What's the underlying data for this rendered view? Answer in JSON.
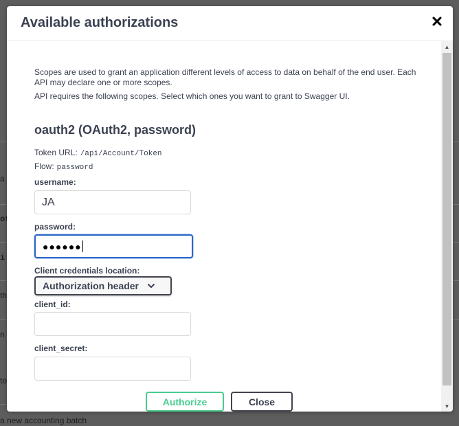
{
  "background": {
    "fragments": [
      "a",
      "ot",
      "i",
      "th",
      "n",
      "to",
      "a new accounting batch"
    ]
  },
  "modal": {
    "title": "Available authorizations",
    "close_icon": "close-icon"
  },
  "scopes": {
    "description": "Scopes are used to grant an application different levels of access to data on behalf of the end user. Each API may declare one or more scopes.",
    "requirement": "API requires the following scopes. Select which ones you want to grant to Swagger UI."
  },
  "scheme": {
    "title": "oauth2 (OAuth2, password)",
    "token_url_label": "Token URL:",
    "token_url": "/api/Account/Token",
    "flow_label": "Flow:",
    "flow": "password"
  },
  "form": {
    "username_label": "username:",
    "username_value": "JA",
    "password_label": "password:",
    "password_masked": "●●●●●●",
    "client_location_label": "Client credentials location:",
    "client_location_value": "Authorization header",
    "client_id_label": "client_id:",
    "client_id_value": "",
    "client_secret_label": "client_secret:",
    "client_secret_value": ""
  },
  "buttons": {
    "authorize": "Authorize",
    "close": "Close"
  },
  "colors": {
    "authorize_green": "#49cc90",
    "focus_blue": "#2b67c6",
    "text": "#3b4151"
  }
}
